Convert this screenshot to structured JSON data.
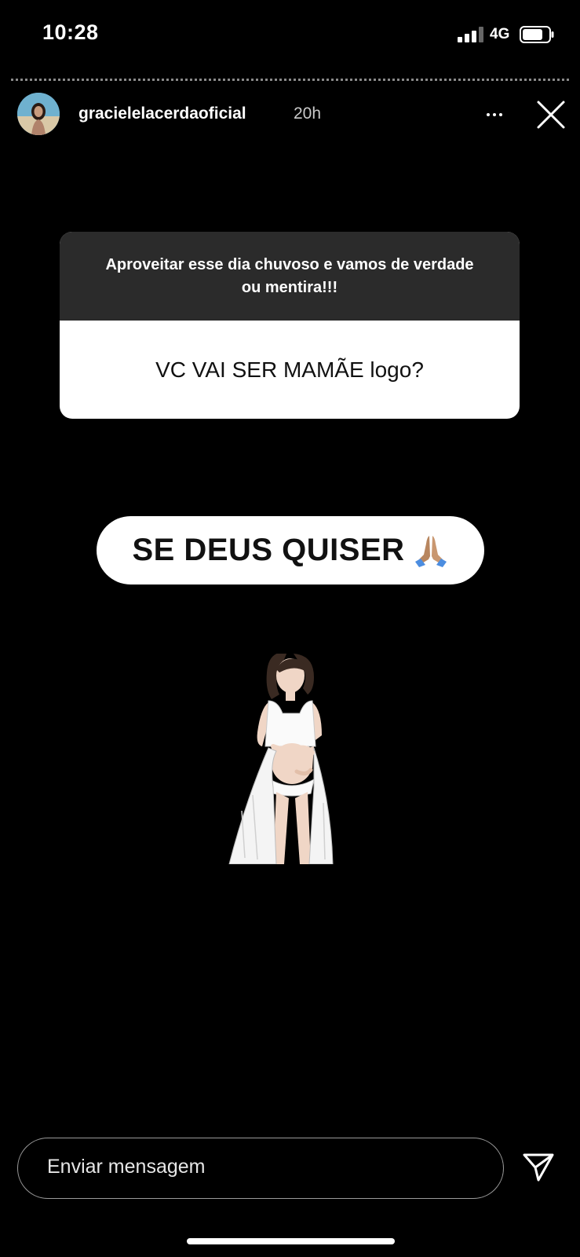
{
  "status_bar": {
    "time": "10:28",
    "network": "4G"
  },
  "story": {
    "username": "gracielelacerdaoficial",
    "time_ago": "20h",
    "question_prompt": "Aproveitar esse dia chuvoso e vamos de verdade ou mentira!!!",
    "question": "VC VAI SER MAMÃE logo?",
    "answer": "SE DEUS QUISER"
  },
  "composer": {
    "placeholder": "Enviar mensagem"
  },
  "icons": [
    "signal-icon",
    "battery-icon",
    "more-icon",
    "close-icon",
    "pray-icon",
    "send-icon"
  ],
  "colors": {
    "background": "#000000",
    "card_header": "#2b2b2b",
    "card_body": "#ffffff"
  }
}
